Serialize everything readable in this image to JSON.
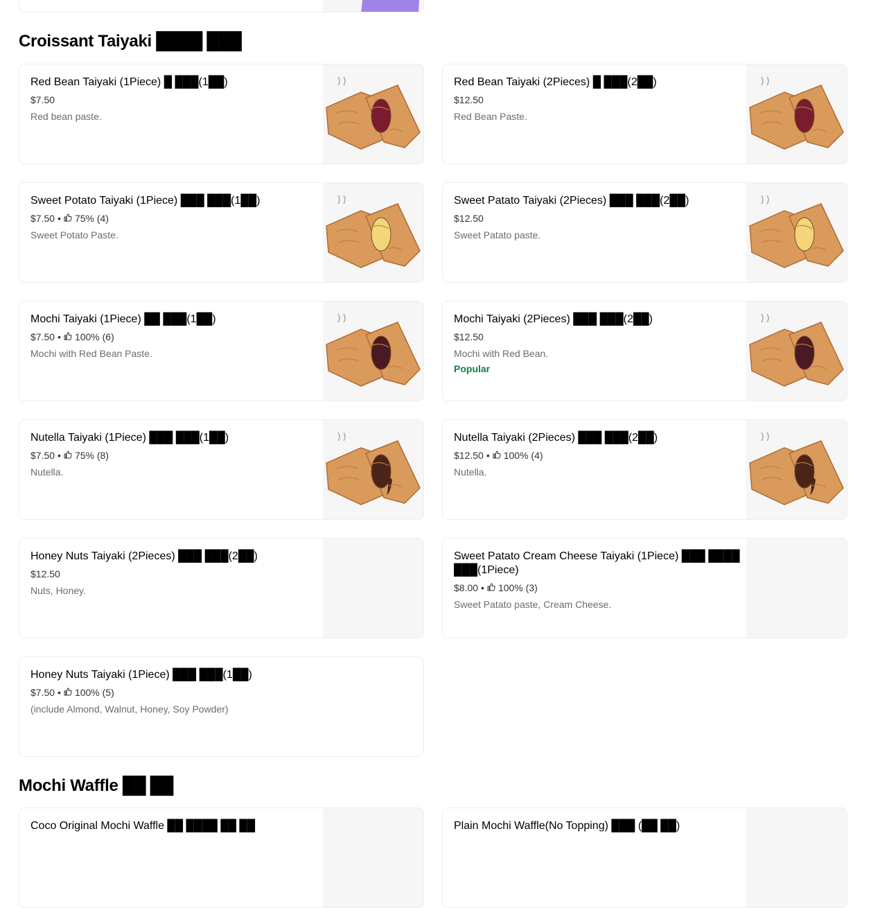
{
  "sections": {
    "croissant": {
      "title": "Croissant Taiyaki ████ ███"
    },
    "mochi_waffle": {
      "title": "Mochi Waffle ██ ██"
    }
  },
  "items": [
    {
      "name": "Red Bean Taiyaki (1Piece) █ ███(1██)",
      "price": "$7.50",
      "rating": "",
      "desc": "Red bean paste.",
      "badge": "",
      "filling": "redbean",
      "has_image": true
    },
    {
      "name": "Red Bean Taiyaki (2Pieces) █ ███(2██)",
      "price": "$12.50",
      "rating": "",
      "desc": "Red Bean Paste.",
      "badge": "",
      "filling": "redbean",
      "has_image": true
    },
    {
      "name": "Sweet Potato Taiyaki (1Piece) ███ ███(1██)",
      "price": "$7.50",
      "rating": "75% (4)",
      "desc": "Sweet Potato Paste.",
      "badge": "",
      "filling": "sweetpotato",
      "has_image": true
    },
    {
      "name": "Sweet Patato Taiyaki (2Pieces) ███ ███(2██)",
      "price": "$12.50",
      "rating": "",
      "desc": "Sweet Patato paste.",
      "badge": "",
      "filling": "sweetpotato",
      "has_image": true
    },
    {
      "name": "Mochi Taiyaki (1Piece) ██ ███(1██)",
      "price": "$7.50",
      "rating": "100% (6)",
      "desc": "Mochi with Red Bean Paste.",
      "badge": "",
      "filling": "mochi",
      "has_image": true
    },
    {
      "name": "Mochi Taiyaki (2Pieces) ███ ███(2██)",
      "price": "$12.50",
      "rating": "",
      "desc": "Mochi with Red Bean.",
      "badge": "Popular",
      "filling": "mochi",
      "has_image": true
    },
    {
      "name": "Nutella Taiyaki (1Piece) ███ ███(1██)",
      "price": "$7.50",
      "rating": "75% (8)",
      "desc": "Nutella.",
      "badge": "",
      "filling": "nutella",
      "has_image": true
    },
    {
      "name": "Nutella Taiyaki (2Pieces) ███ ███(2██)",
      "price": "$12.50",
      "rating": "100% (4)",
      "desc": "Nutella.",
      "badge": "",
      "filling": "nutella",
      "has_image": true
    },
    {
      "name": "Honey Nuts Taiyaki (2Pieces) ███ ███(2██)",
      "price": "$12.50",
      "rating": "",
      "desc": "Nuts, Honey.",
      "badge": "",
      "filling": "",
      "has_image": true
    },
    {
      "name": "Sweet Patato Cream Cheese Taiyaki (1Piece) ███ ████ ███(1Piece)",
      "price": "$8.00",
      "rating": "100% (3)",
      "desc": "Sweet Patato paste, Cream Cheese.",
      "badge": "",
      "filling": "",
      "has_image": true
    },
    {
      "name": "Honey Nuts Taiyaki (1Piece) ███ ███(1██)",
      "price": "$7.50",
      "rating": "100% (5)",
      "desc": "(include Almond, Walnut, Honey, Soy Powder)",
      "badge": "",
      "filling": "",
      "has_image": false
    },
    {
      "name": "Coco Original Mochi Waffle ██ ████ ██ ██",
      "price": "",
      "rating": "",
      "desc": "",
      "badge": "",
      "filling": "",
      "has_image": true
    },
    {
      "name": "Plain Mochi Waffle(No Topping) ███ (██ ██)",
      "price": "",
      "rating": "",
      "desc": "",
      "badge": "",
      "filling": "",
      "has_image": true
    }
  ],
  "colors": {
    "text": "#000000",
    "muted": "#6b6b6b",
    "popular": "#0e8345",
    "border": "#eeeeee",
    "redbean": "#7a1b2e",
    "sweetpotato": "#f3d57a",
    "mochi": "#4a1a22",
    "nutella": "#4b2418",
    "dough": "#d99a5b"
  },
  "icons": {
    "rating": "thumbs-up-icon"
  }
}
